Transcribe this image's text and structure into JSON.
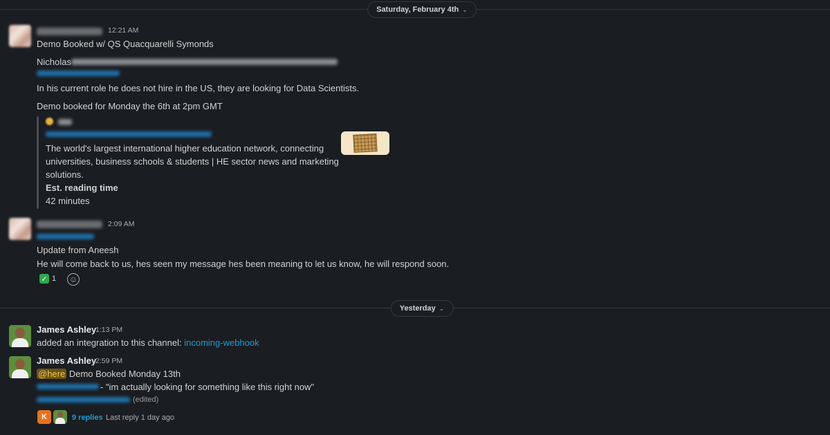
{
  "dates": {
    "first": "Saturday, February 4th",
    "second": "Yesterday"
  },
  "messages": [
    {
      "time": "12:21 AM",
      "lines": {
        "title": "Demo Booked w/ QS Quacquarelli Symonds",
        "contact_name": "Nicholas",
        "role_note": "In his current role he does not hire in the US, they are looking for Data Scientists.",
        "demo_note": "Demo booked for Monday the 6th at 2pm GMT"
      },
      "unfurl": {
        "description": "The world's largest international higher education network, connecting universities, business schools & students | HE sector news and marketing solutions.",
        "desc_line1": "The world's largest international higher education network, connecting",
        "desc_line2": "universities, business schools & students | HE sector news and marketing",
        "desc_line3": "solutions.",
        "reading_label": "Est. reading time",
        "reading_value": "42 minutes"
      }
    },
    {
      "time": "2:09 AM",
      "lines": {
        "update": "Update from Aneesh",
        "detail": "He will come back to us, hes seen my message hes been meaning to let us know, he will respond soon."
      },
      "reaction": {
        "emoji": "✅",
        "count": "1"
      }
    },
    {
      "sender": "James Ashley",
      "time": "1:13 PM",
      "text_prefix": "added an integration to this channel: ",
      "channel_link": "incoming-webhook"
    },
    {
      "sender": "James Ashley",
      "time": "2:59 PM",
      "mention": "@here",
      "headline": " Demo Booked Monday 13th",
      "quote": " - \"im actually looking for something like this right now\"",
      "edited": "(edited)",
      "thread": {
        "replies": "9 replies",
        "last_reply": "Last reply 1 day ago",
        "avatar_letter": "K"
      }
    }
  ],
  "colors": {
    "background": "#1a1d21",
    "link": "#1d9bd1",
    "mention_bg": "#6b5317",
    "mention_text": "#f2c744"
  },
  "icons": [
    "chevron-down-icon",
    "check-mark-emoji-icon",
    "add-reaction-icon"
  ]
}
